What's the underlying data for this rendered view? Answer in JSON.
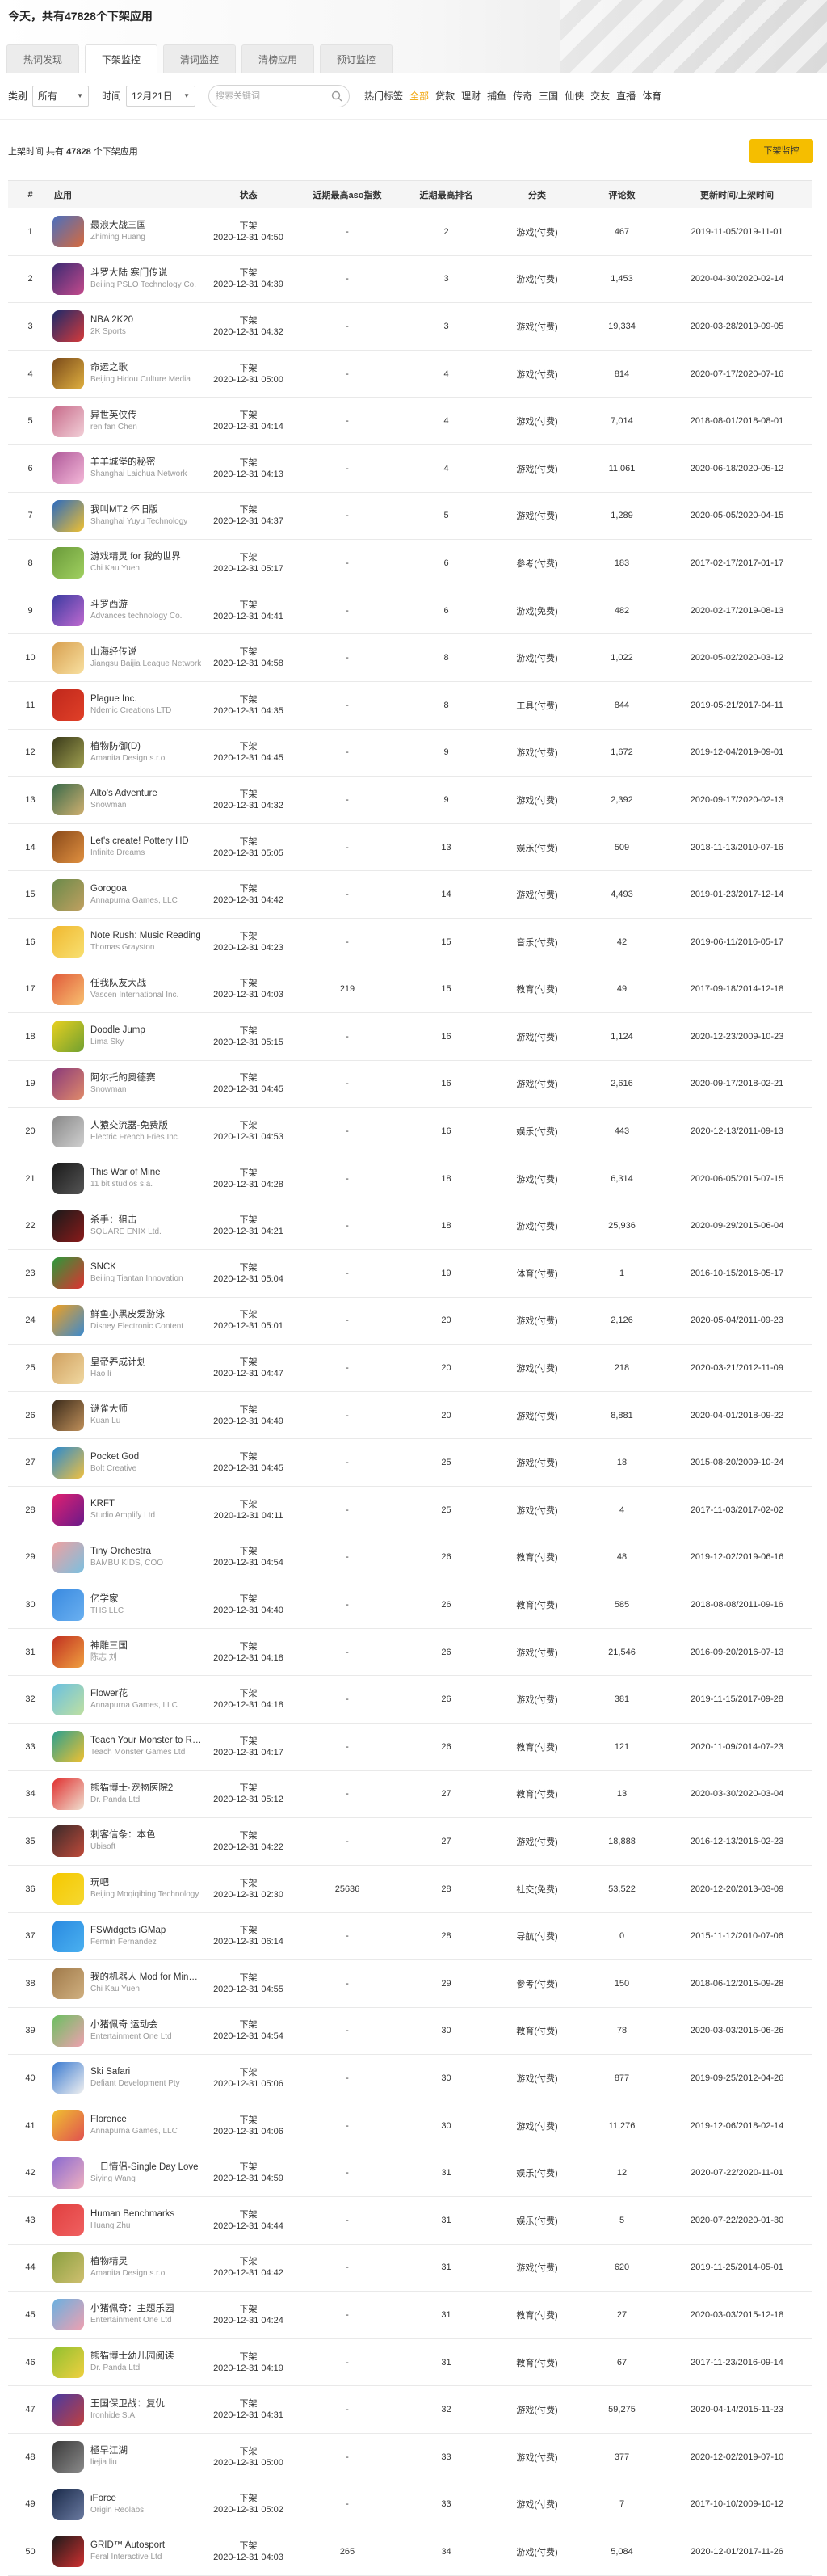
{
  "header": {
    "title": "今天，共有47828个下架应用",
    "tabs": [
      "热词发现",
      "下架监控",
      "清词监控",
      "清榜应用",
      "预订监控"
    ],
    "active_tab": 1
  },
  "filters": {
    "type_label": "类别",
    "type_value": "所有",
    "time_label": "时间",
    "time_value": "12月21日",
    "search_placeholder": "搜索关键词",
    "categories": [
      "热门标签",
      "全部",
      "贷款",
      "理财",
      "捕鱼",
      "传奇",
      "三国",
      "仙侠",
      "交友",
      "直播",
      "体育"
    ],
    "active_category": 1
  },
  "info": {
    "prefix": "上架时间 共有",
    "count": "47828",
    "suffix": "个下架应用",
    "download_button": "下架监控"
  },
  "table": {
    "headers": [
      "#",
      "应用",
      "状态",
      "近期最高aso指数",
      "近期最高排名",
      "分类",
      "评论数",
      "更新时间/上架时间"
    ],
    "rows": [
      {
        "n": "1",
        "name": "最浪大战三国",
        "dev": "Zhiming Huang",
        "s1": "下架",
        "s2": "2020-12-31 04:50",
        "aso": "-",
        "rank": "2",
        "cat": "游戏(付费)",
        "cm": "467",
        "t": "2019-11-05/2019-11-01",
        "c1": "#4a6fbf",
        "c2": "#d96a3b"
      },
      {
        "n": "2",
        "name": "斗罗大陆 寒门传说",
        "dev": "Beijing PSLO Technology Co.",
        "s1": "下架",
        "s2": "2020-12-31 04:39",
        "aso": "-",
        "rank": "3",
        "cat": "游戏(付费)",
        "cm": "1,453",
        "t": "2020-04-30/2020-02-14",
        "c1": "#3b2a72",
        "c2": "#c44a8c"
      },
      {
        "n": "3",
        "name": "NBA 2K20",
        "dev": "2K Sports",
        "s1": "下架",
        "s2": "2020-12-31 04:32",
        "aso": "-",
        "rank": "3",
        "cat": "游戏(付费)",
        "cm": "19,334",
        "t": "2020-03-28/2019-09-05",
        "c1": "#1c2a6b",
        "c2": "#d63a3a"
      },
      {
        "n": "4",
        "name": "命运之歌",
        "dev": "Beijing Hidou Culture Media",
        "s1": "下架",
        "s2": "2020-12-31 05:00",
        "aso": "-",
        "rank": "4",
        "cat": "游戏(付费)",
        "cm": "814",
        "t": "2020-07-17/2020-07-16",
        "c1": "#7a4a1a",
        "c2": "#e0b040"
      },
      {
        "n": "5",
        "name": "异世英侠传",
        "dev": "ren fan Chen",
        "s1": "下架",
        "s2": "2020-12-31 04:14",
        "aso": "-",
        "rank": "4",
        "cat": "游戏(付费)",
        "cm": "7,014",
        "t": "2018-08-01/2018-08-01",
        "c1": "#c76a8a",
        "c2": "#f2d0d8"
      },
      {
        "n": "6",
        "name": "羊羊城堡的秘密",
        "dev": "Shanghai Laichua Network",
        "s1": "下架",
        "s2": "2020-12-31 04:13",
        "aso": "-",
        "rank": "4",
        "cat": "游戏(付费)",
        "cm": "11,061",
        "t": "2020-06-18/2020-05-12",
        "c1": "#b05a9a",
        "c2": "#f4b8d8"
      },
      {
        "n": "7",
        "name": "我叫MT2 怀旧版",
        "dev": "Shanghai Yuyu Technology",
        "s1": "下架",
        "s2": "2020-12-31 04:37",
        "aso": "-",
        "rank": "5",
        "cat": "游戏(付费)",
        "cm": "1,289",
        "t": "2020-05-05/2020-04-15",
        "c1": "#2a6ac0",
        "c2": "#f0c030"
      },
      {
        "n": "8",
        "name": "游戏精灵 for 我的世界",
        "dev": "Chi Kau Yuen",
        "s1": "下架",
        "s2": "2020-12-31 05:17",
        "aso": "-",
        "rank": "6",
        "cat": "参考(付费)",
        "cm": "183",
        "t": "2017-02-17/2017-01-17",
        "c1": "#6a9a3a",
        "c2": "#a0d060"
      },
      {
        "n": "9",
        "name": "斗罗西游",
        "dev": "Advances technology Co.",
        "s1": "下架",
        "s2": "2020-12-31 04:41",
        "aso": "-",
        "rank": "6",
        "cat": "游戏(免费)",
        "cm": "482",
        "t": "2020-02-17/2019-08-13",
        "c1": "#3a3aa0",
        "c2": "#c06ad0"
      },
      {
        "n": "10",
        "name": "山海经传说",
        "dev": "Jiangsu Baijia League Network",
        "s1": "下架",
        "s2": "2020-12-31 04:58",
        "aso": "-",
        "rank": "8",
        "cat": "游戏(付费)",
        "cm": "1,022",
        "t": "2020-05-02/2020-03-12",
        "c1": "#d8a050",
        "c2": "#f8e0a0"
      },
      {
        "n": "11",
        "name": "Plague Inc.",
        "dev": "Ndemic Creations LTD",
        "s1": "下架",
        "s2": "2020-12-31 04:35",
        "aso": "-",
        "rank": "8",
        "cat": "工具(付费)",
        "cm": "844",
        "t": "2019-05-21/2017-04-11",
        "c1": "#c0281c",
        "c2": "#e04028"
      },
      {
        "n": "12",
        "name": "植物防御(D)",
        "dev": "Amanita Design s.r.o.",
        "s1": "下架",
        "s2": "2020-12-31 04:45",
        "aso": "-",
        "rank": "9",
        "cat": "游戏(付费)",
        "cm": "1,672",
        "t": "2019-12-04/2019-09-01",
        "c1": "#3a3a1a",
        "c2": "#a0a050"
      },
      {
        "n": "13",
        "name": "Alto's Adventure",
        "dev": "Snowman",
        "s1": "下架",
        "s2": "2020-12-31 04:32",
        "aso": "-",
        "rank": "9",
        "cat": "游戏(付费)",
        "cm": "2,392",
        "t": "2020-09-17/2020-02-13",
        "c1": "#3a6a4a",
        "c2": "#d0b070"
      },
      {
        "n": "14",
        "name": "Let's create! Pottery HD",
        "dev": "Infinite Dreams",
        "s1": "下架",
        "s2": "2020-12-31 05:05",
        "aso": "-",
        "rank": "13",
        "cat": "娱乐(付费)",
        "cm": "509",
        "t": "2018-11-13/2010-07-16",
        "c1": "#8a4a1a",
        "c2": "#e09040"
      },
      {
        "n": "15",
        "name": "Gorogoa",
        "dev": "Annapurna Games, LLC",
        "s1": "下架",
        "s2": "2020-12-31 04:42",
        "aso": "-",
        "rank": "14",
        "cat": "游戏(付费)",
        "cm": "4,493",
        "t": "2019-01-23/2017-12-14",
        "c1": "#6a8a4a",
        "c2": "#c0a060"
      },
      {
        "n": "16",
        "name": "Note Rush: Music Reading",
        "dev": "Thomas Grayston",
        "s1": "下架",
        "s2": "2020-12-31 04:23",
        "aso": "-",
        "rank": "15",
        "cat": "音乐(付费)",
        "cm": "42",
        "t": "2019-06-11/2016-05-17",
        "c1": "#f0b830",
        "c2": "#f8e070"
      },
      {
        "n": "17",
        "name": "任我队友大战",
        "dev": "Vascen International Inc.",
        "s1": "下架",
        "s2": "2020-12-31 04:03",
        "aso": "219",
        "rank": "15",
        "cat": "教育(付费)",
        "cm": "49",
        "t": "2017-09-18/2014-12-18",
        "c1": "#e05a3a",
        "c2": "#f8c070"
      },
      {
        "n": "18",
        "name": "Doodle Jump",
        "dev": "Lima Sky",
        "s1": "下架",
        "s2": "2020-12-31 05:15",
        "aso": "-",
        "rank": "16",
        "cat": "游戏(付费)",
        "cm": "1,124",
        "t": "2020-12-23/2009-10-23",
        "c1": "#e8d020",
        "c2": "#70a030"
      },
      {
        "n": "19",
        "name": "阿尔托的奥德赛",
        "dev": "Snowman",
        "s1": "下架",
        "s2": "2020-12-31 04:45",
        "aso": "-",
        "rank": "16",
        "cat": "游戏(付费)",
        "cm": "2,616",
        "t": "2020-09-17/2018-02-21",
        "c1": "#8a3a7a",
        "c2": "#e08a6a"
      },
      {
        "n": "20",
        "name": "人猿交流器-免费版",
        "dev": "Electric French Fries Inc.",
        "s1": "下架",
        "s2": "2020-12-31 04:53",
        "aso": "-",
        "rank": "16",
        "cat": "娱乐(付费)",
        "cm": "443",
        "t": "2020-12-13/2011-09-13",
        "c1": "#888888",
        "c2": "#d0d0d0"
      },
      {
        "n": "21",
        "name": "This War of Mine",
        "dev": "11 bit studios s.a.",
        "s1": "下架",
        "s2": "2020-12-31 04:28",
        "aso": "-",
        "rank": "18",
        "cat": "游戏(付费)",
        "cm": "6,314",
        "t": "2020-06-05/2015-07-15",
        "c1": "#1a1a1a",
        "c2": "#555555"
      },
      {
        "n": "22",
        "name": "杀手：狙击",
        "dev": "SQUARE ENIX Ltd.",
        "s1": "下架",
        "s2": "2020-12-31 04:21",
        "aso": "-",
        "rank": "18",
        "cat": "游戏(付费)",
        "cm": "25,936",
        "t": "2020-09-29/2015-06-04",
        "c1": "#1a1a1a",
        "c2": "#8a1a1a"
      },
      {
        "n": "23",
        "name": "SNCK",
        "dev": "Beijing Tiantan Innovation",
        "s1": "下架",
        "s2": "2020-12-31 05:04",
        "aso": "-",
        "rank": "19",
        "cat": "体育(付费)",
        "cm": "1",
        "t": "2016-10-15/2016-05-17",
        "c1": "#2a9a3a",
        "c2": "#e03030"
      },
      {
        "n": "24",
        "name": "鲜鱼小黑皮爱游泳",
        "dev": "Disney Electronic Content",
        "s1": "下架",
        "s2": "2020-12-31 05:01",
        "aso": "-",
        "rank": "20",
        "cat": "游戏(付费)",
        "cm": "2,126",
        "t": "2020-05-04/2011-09-23",
        "c1": "#f0a020",
        "c2": "#3a8ad0"
      },
      {
        "n": "25",
        "name": "皇帝养成计划",
        "dev": "Hao li",
        "s1": "下架",
        "s2": "2020-12-31 04:47",
        "aso": "-",
        "rank": "20",
        "cat": "游戏(付费)",
        "cm": "218",
        "t": "2020-03-21/2012-11-09",
        "c1": "#d0a060",
        "c2": "#f0d8a0"
      },
      {
        "n": "26",
        "name": "谜雀大师",
        "dev": "Kuan Lu",
        "s1": "下架",
        "s2": "2020-12-31 04:49",
        "aso": "-",
        "rank": "20",
        "cat": "游戏(付费)",
        "cm": "8,881",
        "t": "2020-04-01/2018-09-22",
        "c1": "#3a2a1a",
        "c2": "#c0905a"
      },
      {
        "n": "27",
        "name": "Pocket God",
        "dev": "Bolt Creative",
        "s1": "下架",
        "s2": "2020-12-31 04:45",
        "aso": "-",
        "rank": "25",
        "cat": "游戏(付费)",
        "cm": "18",
        "t": "2015-08-20/2009-10-24",
        "c1": "#2a8ad0",
        "c2": "#f0c040"
      },
      {
        "n": "28",
        "name": "KRFT",
        "dev": "Studio Amplify Ltd",
        "s1": "下架",
        "s2": "2020-12-31 04:11",
        "aso": "-",
        "rank": "25",
        "cat": "游戏(付费)",
        "cm": "4",
        "t": "2017-11-03/2017-02-02",
        "c1": "#e02070",
        "c2": "#6a1a8a"
      },
      {
        "n": "29",
        "name": "Tiny Orchestra",
        "dev": "BAMBU KIDS, COO",
        "s1": "下架",
        "s2": "2020-12-31 04:54",
        "aso": "-",
        "rank": "26",
        "cat": "教育(付费)",
        "cm": "48",
        "t": "2019-12-02/2019-06-16",
        "c1": "#f0a0a0",
        "c2": "#7ac0e0"
      },
      {
        "n": "30",
        "name": "亿学家",
        "dev": "THS LLC",
        "s1": "下架",
        "s2": "2020-12-31 04:40",
        "aso": "-",
        "rank": "26",
        "cat": "教育(付费)",
        "cm": "585",
        "t": "2018-08-08/2011-09-16",
        "c1": "#3a8ae0",
        "c2": "#6ab0f0"
      },
      {
        "n": "31",
        "name": "神雕三国",
        "dev": "陈志 刘",
        "s1": "下架",
        "s2": "2020-12-31 04:18",
        "aso": "-",
        "rank": "26",
        "cat": "游戏(付费)",
        "cm": "21,546",
        "t": "2016-09-20/2016-07-13",
        "c1": "#c03020",
        "c2": "#f0a040"
      },
      {
        "n": "32",
        "name": "Flower花",
        "dev": "Annapurna Games, LLC",
        "s1": "下架",
        "s2": "2020-12-31 04:18",
        "aso": "-",
        "rank": "26",
        "cat": "游戏(付费)",
        "cm": "381",
        "t": "2019-11-15/2017-09-28",
        "c1": "#6ac0e0",
        "c2": "#c0e0a0"
      },
      {
        "n": "33",
        "name": "Teach Your Monster to Read",
        "dev": "Teach Monster Games Ltd",
        "s1": "下架",
        "s2": "2020-12-31 04:17",
        "aso": "-",
        "rank": "26",
        "cat": "教育(付费)",
        "cm": "121",
        "t": "2020-11-09/2014-07-23",
        "c1": "#2aa090",
        "c2": "#f0c030"
      },
      {
        "n": "34",
        "name": "熊猫博士·宠物医院2",
        "dev": "Dr. Panda Ltd",
        "s1": "下架",
        "s2": "2020-12-31 05:12",
        "aso": "-",
        "rank": "27",
        "cat": "教育(付费)",
        "cm": "13",
        "t": "2020-03-30/2020-03-04",
        "c1": "#e03030",
        "c2": "#f0e0d0"
      },
      {
        "n": "35",
        "name": "刺客信条：本色",
        "dev": "Ubisoft",
        "s1": "下架",
        "s2": "2020-12-31 04:22",
        "aso": "-",
        "rank": "27",
        "cat": "游戏(付费)",
        "cm": "18,888",
        "t": "2016-12-13/2016-02-23",
        "c1": "#3a2a2a",
        "c2": "#c04a3a"
      },
      {
        "n": "36",
        "name": "玩吧",
        "dev": "Beijing Moqiqibing Technology",
        "s1": "下架",
        "s2": "2020-12-31 02:30",
        "aso": "25636",
        "rank": "28",
        "cat": "社交(免费)",
        "cm": "53,522",
        "t": "2020-12-20/2013-03-09",
        "c1": "#f5c800",
        "c2": "#f5d830"
      },
      {
        "n": "37",
        "name": "FSWidgets iGMap",
        "dev": "Fermin Fernandez",
        "s1": "下架",
        "s2": "2020-12-31 06:14",
        "aso": "-",
        "rank": "28",
        "cat": "导航(付费)",
        "cm": "0",
        "t": "2015-11-12/2010-07-06",
        "c1": "#2a8ae0",
        "c2": "#4ab0f0"
      },
      {
        "n": "38",
        "name": "我的机器人 Mod for Minecraft",
        "dev": "Chi Kau Yuen",
        "s1": "下架",
        "s2": "2020-12-31 04:55",
        "aso": "-",
        "rank": "29",
        "cat": "参考(付费)",
        "cm": "150",
        "t": "2018-06-12/2016-09-28",
        "c1": "#a07a4a",
        "c2": "#d0b080"
      },
      {
        "n": "39",
        "name": "小猪佩奇 运动会",
        "dev": "Entertainment One Ltd",
        "s1": "下架",
        "s2": "2020-12-31 04:54",
        "aso": "-",
        "rank": "30",
        "cat": "教育(付费)",
        "cm": "78",
        "t": "2020-03-03/2016-06-26",
        "c1": "#6ac060",
        "c2": "#f0a0b0"
      },
      {
        "n": "40",
        "name": "Ski Safari",
        "dev": "Defiant Development Pty",
        "s1": "下架",
        "s2": "2020-12-31 05:06",
        "aso": "-",
        "rank": "30",
        "cat": "游戏(付费)",
        "cm": "877",
        "t": "2019-09-25/2012-04-26",
        "c1": "#3a7ad0",
        "c2": "#f0f0f0"
      },
      {
        "n": "41",
        "name": "Florence",
        "dev": "Annapurna Games, LLC",
        "s1": "下架",
        "s2": "2020-12-31 04:06",
        "aso": "-",
        "rank": "30",
        "cat": "游戏(付费)",
        "cm": "11,276",
        "t": "2019-12-06/2018-02-14",
        "c1": "#f0c030",
        "c2": "#e05050"
      },
      {
        "n": "42",
        "name": "一日情侣-Single Day Love",
        "dev": "Siying Wang",
        "s1": "下架",
        "s2": "2020-12-31 04:59",
        "aso": "-",
        "rank": "31",
        "cat": "娱乐(付费)",
        "cm": "12",
        "t": "2020-07-22/2020-11-01",
        "c1": "#8a6ad0",
        "c2": "#f0b0c0"
      },
      {
        "n": "43",
        "name": "Human Benchmarks",
        "dev": "Huang Zhu",
        "s1": "下架",
        "s2": "2020-12-31 04:44",
        "aso": "-",
        "rank": "31",
        "cat": "娱乐(付费)",
        "cm": "5",
        "t": "2020-07-22/2020-01-30",
        "c1": "#e04040",
        "c2": "#f06060"
      },
      {
        "n": "44",
        "name": "植物精灵",
        "dev": "Amanita Design s.r.o.",
        "s1": "下架",
        "s2": "2020-12-31 04:42",
        "aso": "-",
        "rank": "31",
        "cat": "游戏(付费)",
        "cm": "620",
        "t": "2019-11-25/2014-05-01",
        "c1": "#8aa040",
        "c2": "#d0c070"
      },
      {
        "n": "45",
        "name": "小猪佩奇：主题乐园",
        "dev": "Entertainment One Ltd",
        "s1": "下架",
        "s2": "2020-12-31 04:24",
        "aso": "-",
        "rank": "31",
        "cat": "教育(付费)",
        "cm": "27",
        "t": "2020-03-03/2015-12-18",
        "c1": "#6ab0e0",
        "c2": "#f0a0b0"
      },
      {
        "n": "46",
        "name": "熊猫博士幼儿园阅读",
        "dev": "Dr. Panda Ltd",
        "s1": "下架",
        "s2": "2020-12-31 04:19",
        "aso": "-",
        "rank": "31",
        "cat": "教育(付费)",
        "cm": "67",
        "t": "2017-11-23/2016-09-14",
        "c1": "#90c030",
        "c2": "#f0d040"
      },
      {
        "n": "47",
        "name": "王国保卫战：复仇",
        "dev": "Ironhide S.A.",
        "s1": "下架",
        "s2": "2020-12-31 04:31",
        "aso": "-",
        "rank": "32",
        "cat": "游戏(付费)",
        "cm": "59,275",
        "t": "2020-04-14/2015-11-23",
        "c1": "#4a3aa0",
        "c2": "#c04040"
      },
      {
        "n": "48",
        "name": "極早江湖",
        "dev": "liejia liu",
        "s1": "下架",
        "s2": "2020-12-31 05:00",
        "aso": "-",
        "rank": "33",
        "cat": "游戏(付费)",
        "cm": "377",
        "t": "2020-12-02/2019-07-10",
        "c1": "#3a3a3a",
        "c2": "#8a8a8a"
      },
      {
        "n": "49",
        "name": "iForce",
        "dev": "Origin Reolabs",
        "s1": "下架",
        "s2": "2020-12-31 05:02",
        "aso": "-",
        "rank": "33",
        "cat": "游戏(付费)",
        "cm": "7",
        "t": "2017-10-10/2009-10-12",
        "c1": "#1a2a4a",
        "c2": "#6a7aa0"
      },
      {
        "n": "50",
        "name": "GRID™ Autosport",
        "dev": "Feral Interactive Ltd",
        "s1": "下架",
        "s2": "2020-12-31 04:03",
        "aso": "265",
        "rank": "34",
        "cat": "游戏(付费)",
        "cm": "5,084",
        "t": "2020-12-01/2017-11-26",
        "c1": "#1a1a1a",
        "c2": "#d03030"
      }
    ]
  }
}
